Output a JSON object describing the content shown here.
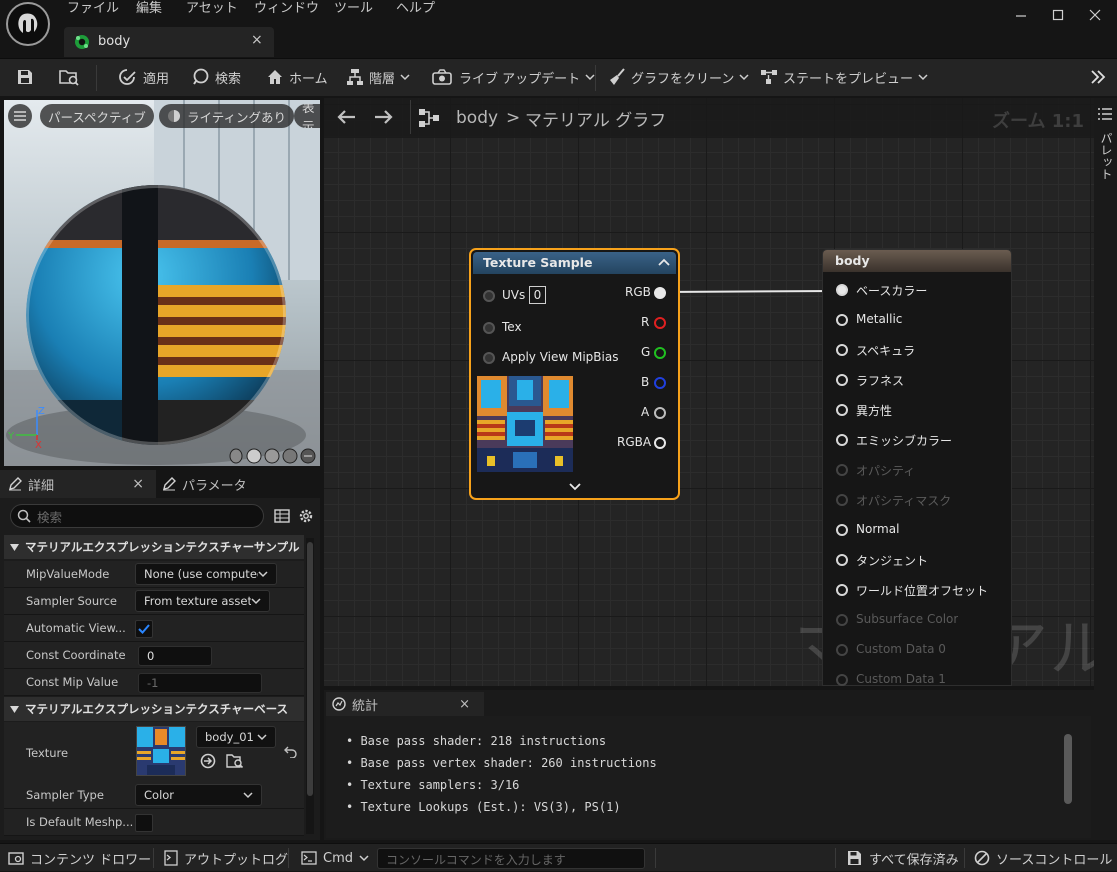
{
  "menu": [
    "ファイル",
    "編集",
    "アセット",
    "ウィンドウ",
    "ツール",
    "ヘルプ"
  ],
  "doc_tab": {
    "title": "body"
  },
  "toolbar": {
    "apply": "適用",
    "search": "検索",
    "home": "ホーム",
    "hierarchy": "階層",
    "live_update": "ライブ アップデート",
    "clean_graph": "グラフをクリーン",
    "preview_state": "ステートをプレビュー"
  },
  "viewport": {
    "perspective": "パースペクティブ",
    "lighting": "ライティングあり",
    "show": "表示"
  },
  "details": {
    "tab_details": "詳細",
    "tab_params": "パラメータ",
    "search_placeholder": "検索",
    "cat1": "マテリアルエクスプレッションテクスチャーサンプル",
    "cat2": "マテリアルエクスプレッションテクスチャーベース",
    "rows": {
      "mip_label": "MipValueMode",
      "mip_value": "None (use computed",
      "sampler_source_label": "Sampler Source",
      "sampler_source_value": "From texture asset",
      "auto_view_label": "Automatic View...",
      "const_coord_label": "Const Coordinate",
      "const_coord_value": "0",
      "const_mip_label": "Const Mip Value",
      "const_mip_value": "-1",
      "texture_label": "Texture",
      "texture_value": "body_01",
      "sampler_type_label": "Sampler Type",
      "sampler_type_value": "Color",
      "is_default_label": "Is Default Meshp..."
    }
  },
  "graph": {
    "breadcrumb_root": "body",
    "breadcrumb_sep": ">",
    "breadcrumb_leaf": "マテリアル グラフ",
    "zoom": "ズーム 1:1",
    "watermark": "マテリアル"
  },
  "texture_node": {
    "title": "Texture Sample",
    "inputs": {
      "uvs": "UVs",
      "uvs_value": "0",
      "tex": "Tex",
      "mipbias": "Apply View MipBias"
    },
    "outputs": {
      "rgb": "RGB",
      "r": "R",
      "g": "G",
      "b": "B",
      "a": "A",
      "rgba": "RGBA"
    }
  },
  "material_node": {
    "title": "body",
    "pins": [
      "ベースカラー",
      "Metallic",
      "スペキュラ",
      "ラフネス",
      "異方性",
      "エミッシブカラー",
      "オパシティ",
      "オパシティマスク",
      "Normal",
      "タンジェント",
      "ワールド位置オフセット",
      "Subsurface Color",
      "Custom Data 0",
      "Custom Data 1"
    ]
  },
  "palette": {
    "label": "パレット"
  },
  "stats": {
    "tab": "統計",
    "lines": [
      "Base pass shader: 218 instructions",
      "Base pass vertex shader: 260 instructions",
      "Texture samplers: 3/16",
      "Texture Lookups (Est.): VS(3), PS(1)"
    ]
  },
  "statusbar": {
    "content_drawer": "コンテンツ ドロワー",
    "output_log": "アウトプットログ",
    "cmd": "Cmd",
    "console_placeholder": "コンソールコマンドを入力します",
    "save_all": "すべて保存済み",
    "source_control": "ソースコントロール"
  },
  "colors": {
    "accent_orange": "#f7a21b",
    "node_header_blue": "#2b4c6e",
    "pin_r": "#e02020",
    "pin_g": "#20c020",
    "pin_b": "#2040e0",
    "check_blue": "#1e6fd6"
  }
}
